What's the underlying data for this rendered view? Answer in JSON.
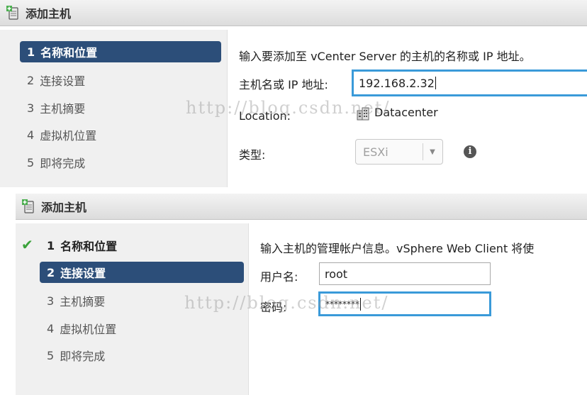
{
  "watermark": "http://blog.csdn.net/",
  "panel1": {
    "title": "添加主机",
    "steps": [
      {
        "num": "1",
        "label": "名称和位置"
      },
      {
        "num": "2",
        "label": "连接设置"
      },
      {
        "num": "3",
        "label": "主机摘要"
      },
      {
        "num": "4",
        "label": "虚拟机位置"
      },
      {
        "num": "5",
        "label": "即将完成"
      }
    ],
    "instruction": "输入要添加至 vCenter Server 的主机的名称或 IP 地址。",
    "host_label": "主机名或 IP 地址:",
    "host_value": "192.168.2.32",
    "location_label": "Location:",
    "location_value": "Datacenter",
    "type_label": "类型:",
    "type_value": "ESXi",
    "info_glyph": "i"
  },
  "panel2": {
    "title": "添加主机",
    "check_glyph": "✔",
    "steps": [
      {
        "num": "1",
        "label": "名称和位置"
      },
      {
        "num": "2",
        "label": "连接设置"
      },
      {
        "num": "3",
        "label": "主机摘要"
      },
      {
        "num": "4",
        "label": "虚拟机位置"
      },
      {
        "num": "5",
        "label": "即将完成"
      }
    ],
    "instruction": "输入主机的管理帐户信息。vSphere Web Client 将使",
    "username_label": "用户名:",
    "username_value": "root",
    "password_label": "密码:",
    "password_value": "********"
  },
  "colors": {
    "active_step": "#2c4e79",
    "focus_border": "#3a9ad9",
    "check": "#3aa23a"
  }
}
